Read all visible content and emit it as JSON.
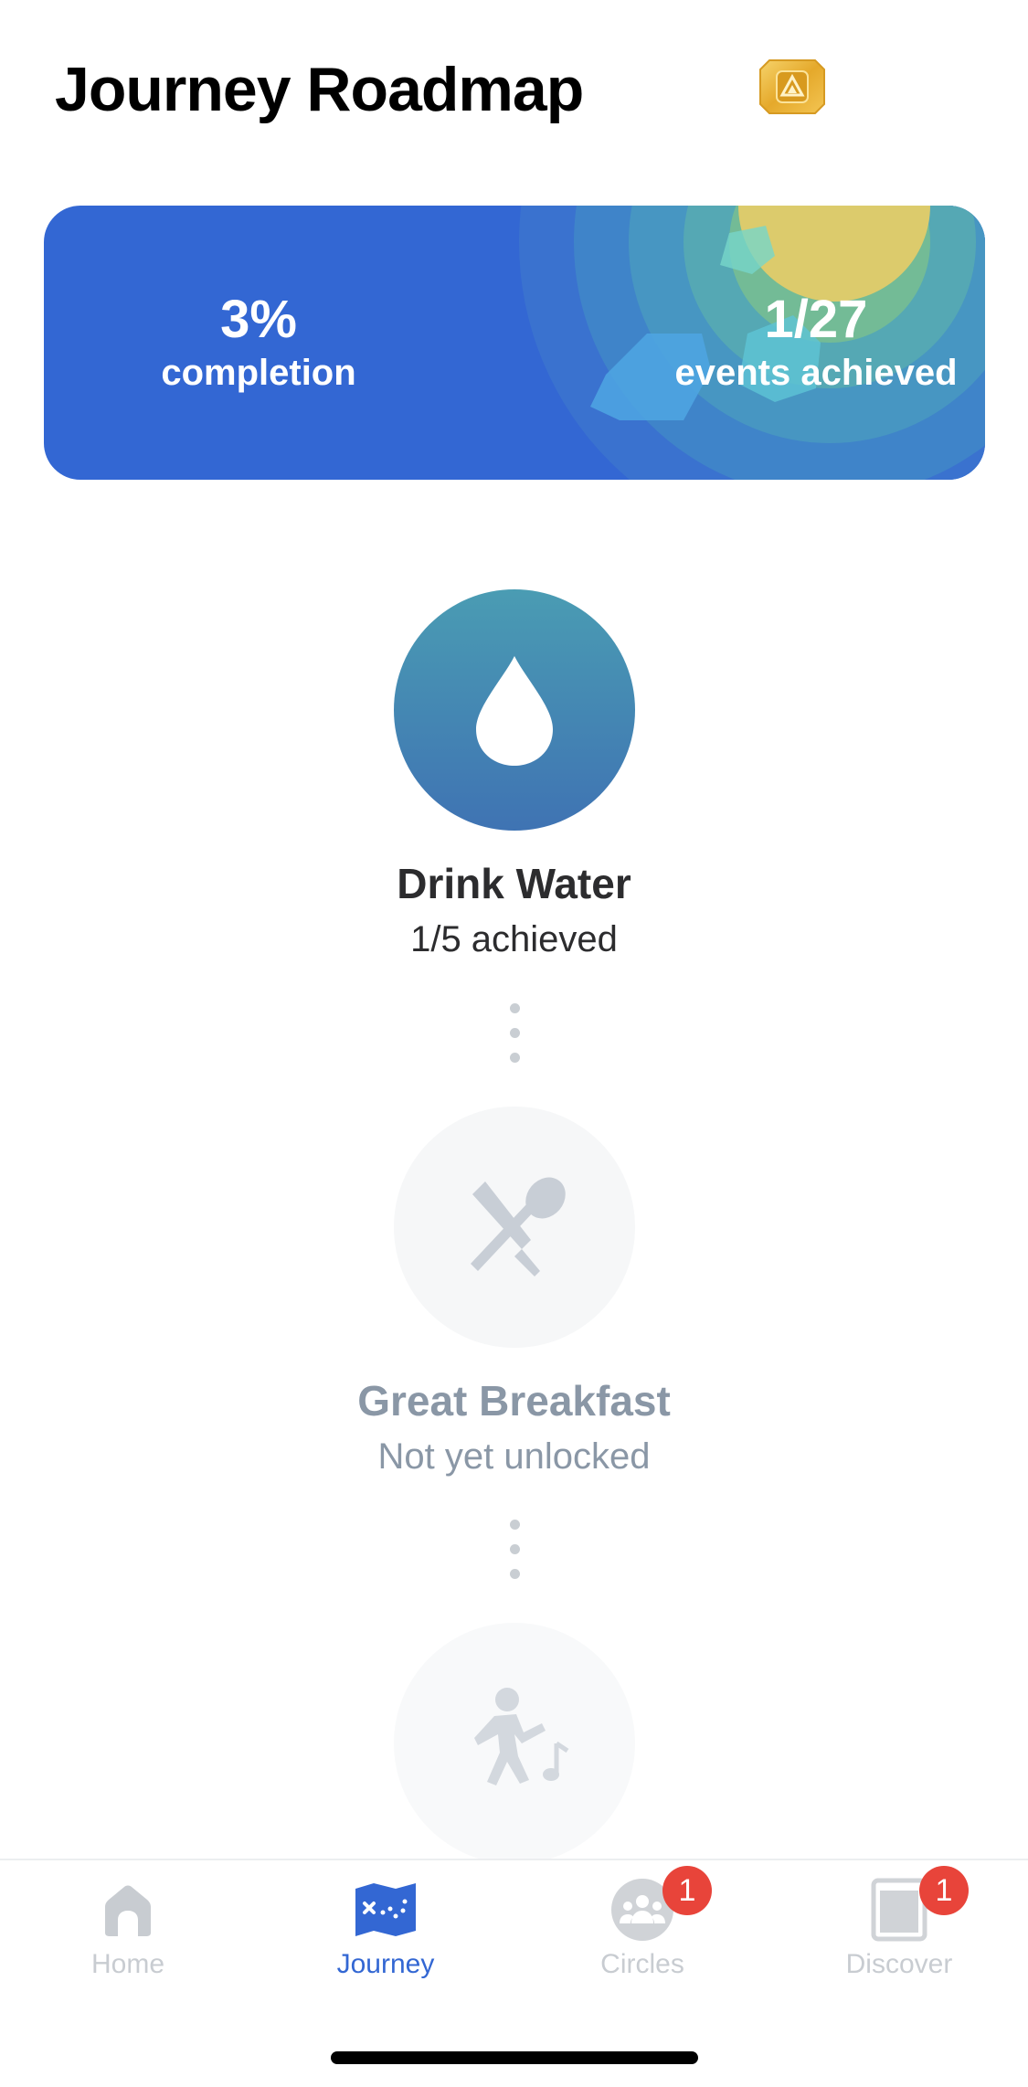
{
  "header": {
    "title": "Journey Roadmap",
    "badge_icon": "gold-badge-icon"
  },
  "stats": {
    "completion_value": "3%",
    "completion_label": "completion",
    "events_value": "1/27",
    "events_label": "events achieved",
    "background_color": "#3367d3"
  },
  "roadmap": [
    {
      "title": "Drink Water",
      "status": "1/5 achieved",
      "icon": "water-drop-icon",
      "state": "active"
    },
    {
      "title": "Great Breakfast",
      "status": "Not yet unlocked",
      "icon": "utensils-icon",
      "state": "locked"
    },
    {
      "title": "",
      "status": "",
      "icon": "dancing-person-icon",
      "state": "locked"
    }
  ],
  "tabbar": {
    "tabs": [
      {
        "label": "Home",
        "icon": "home-icon",
        "active": false,
        "badge": null
      },
      {
        "label": "Journey",
        "icon": "journey-map-icon",
        "active": true,
        "badge": null
      },
      {
        "label": "Circles",
        "icon": "circles-group-icon",
        "active": false,
        "badge": "1"
      },
      {
        "label": "Discover",
        "icon": "discover-icon",
        "active": false,
        "badge": "1"
      }
    ],
    "active_color": "#3367d3",
    "badge_color": "#e8443a"
  }
}
